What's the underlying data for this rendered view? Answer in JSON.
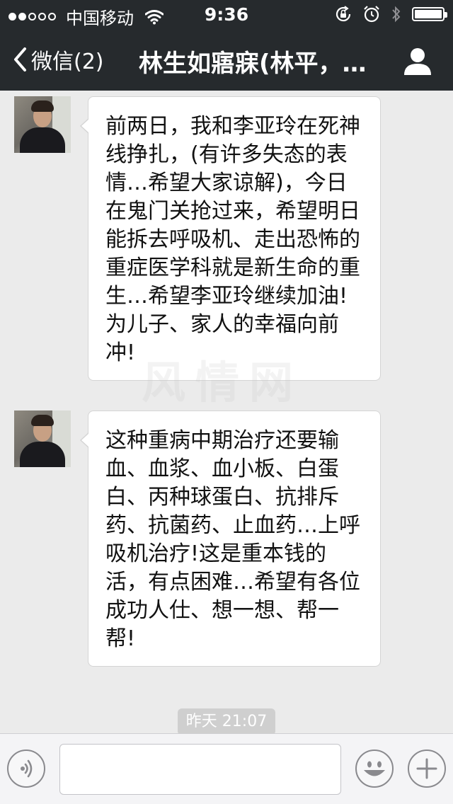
{
  "status_bar": {
    "carrier": "中国移动",
    "time": "9:36",
    "signal_bars_filled": 2,
    "signal_bars_total": 5,
    "icons": [
      "wifi-icon",
      "rotation-lock-icon",
      "alarm-icon",
      "bluetooth-icon",
      "battery-icon"
    ]
  },
  "nav": {
    "back_label": "微信(2)",
    "title": "林生如寤寐(林平，…",
    "back_icon": "chevron-left-icon",
    "profile_icon": "person-icon"
  },
  "messages": [
    {
      "avatar": "avatar",
      "text": "前两日，我和李亚玲在死神线挣扎，(有许多失态的表情…希望大家谅解)，今日在鬼门关抢过来，希望明日能拆去呼吸机、走出恐怖的重症医学科就是新生命的重生…希望李亚玲继续加油!为儿子、家人的幸福向前冲!"
    },
    {
      "avatar": "avatar",
      "text": "这种重病中期治疗还要输血、血浆、血小板、白蛋白、丙种球蛋白、抗排斥药、抗菌药、止血药…上呼吸机治疗!这是重本钱的活，有点困难…希望有各位成功人仕、想一想、帮一帮!"
    }
  ],
  "watermark": "风情网",
  "timestamp": "昨天 21:07",
  "input_bar": {
    "value": "",
    "placeholder": "",
    "icons": [
      "voice-icon",
      "emoji-icon",
      "plus-icon"
    ]
  },
  "colors": {
    "bar_background": "#262a2d",
    "chat_background": "#ebebeb",
    "bubble_background": "#ffffff",
    "timestamp_background": "#cfcfcf"
  }
}
